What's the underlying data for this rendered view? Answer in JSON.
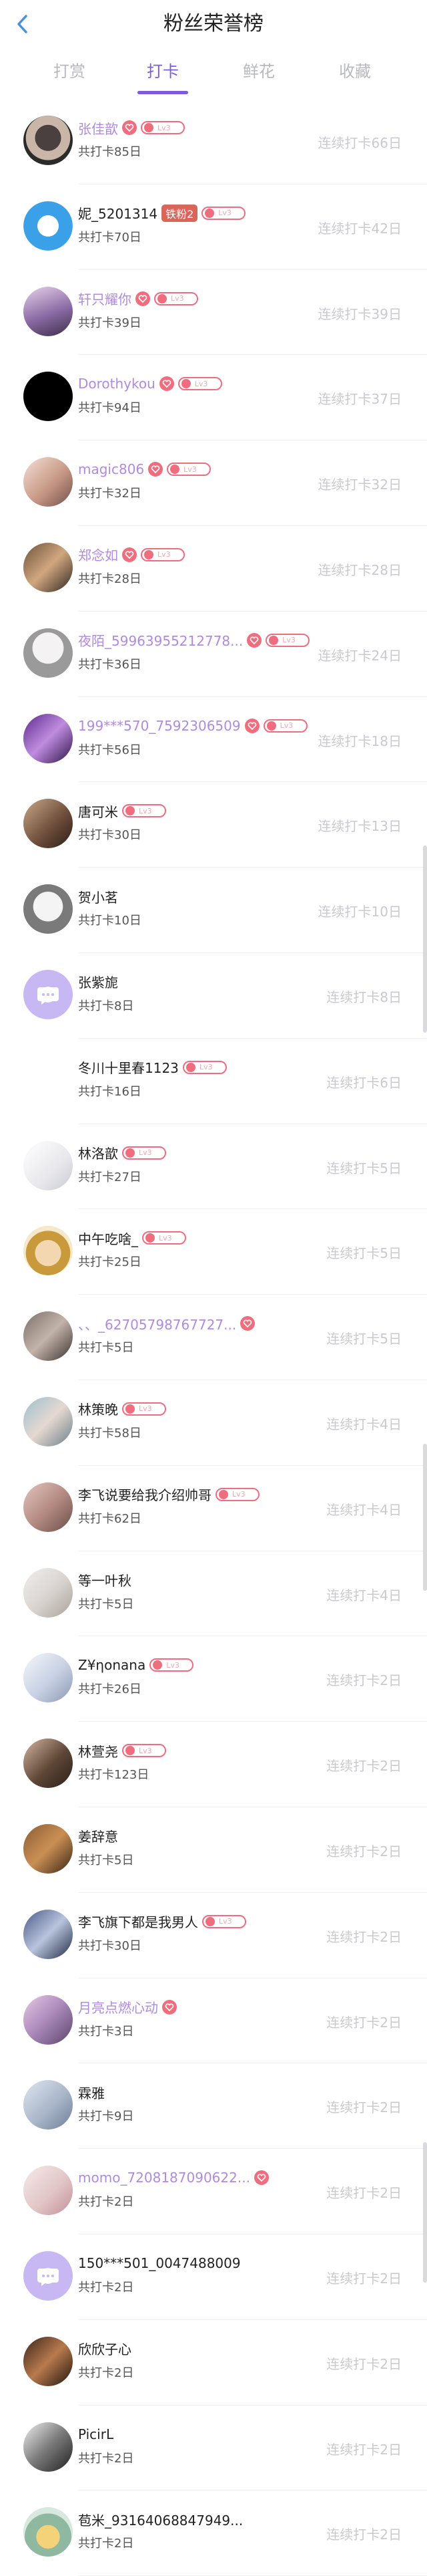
{
  "header": {
    "title": "粉丝荣誉榜"
  },
  "tabs": [
    {
      "label": "打赏"
    },
    {
      "label": "打卡"
    },
    {
      "label": "鲜花"
    },
    {
      "label": "收藏"
    }
  ],
  "badge_level_text": "Lv3",
  "colors": {
    "accent": "#7c5cd9",
    "badge": "#f06d7e",
    "vip_name": "#b08ae0",
    "muted": "#c9c9cf"
  },
  "rows": [
    {
      "name": "张佳歆",
      "sub": "共打卡85日",
      "streak": "连续打卡66日",
      "vip": true,
      "heart": true,
      "level": true
    },
    {
      "name": "妮_5201314",
      "sub": "共打卡70日",
      "streak": "连续打卡42日",
      "vip": false,
      "fans": "铁粉2",
      "level": true
    },
    {
      "name": "轩只耀你",
      "sub": "共打卡39日",
      "streak": "连续打卡39日",
      "vip": true,
      "heart": true,
      "level": true
    },
    {
      "name": "Dorothykou",
      "sub": "共打卡94日",
      "streak": "连续打卡37日",
      "vip": true,
      "heart": true,
      "level": true
    },
    {
      "name": "magic806",
      "sub": "共打卡32日",
      "streak": "连续打卡32日",
      "vip": true,
      "heart": true,
      "level": true
    },
    {
      "name": "郑念如",
      "sub": "共打卡28日",
      "streak": "连续打卡28日",
      "vip": true,
      "heart": true,
      "level": true
    },
    {
      "name": "夜陌_59963955212778...",
      "sub": "共打卡36日",
      "streak": "连续打卡24日",
      "vip": true,
      "heart": true,
      "level": true
    },
    {
      "name": "199***570_7592306509",
      "sub": "共打卡56日",
      "streak": "连续打卡18日",
      "vip": true,
      "heart": true,
      "level": true
    },
    {
      "name": "唐可米",
      "sub": "共打卡30日",
      "streak": "连续打卡13日",
      "vip": false,
      "level": true
    },
    {
      "name": "贺小茗",
      "sub": "共打卡10日",
      "streak": "连续打卡10日",
      "vip": false
    },
    {
      "name": "张紫旎",
      "sub": "共打卡8日",
      "streak": "连续打卡8日",
      "vip": false
    },
    {
      "name": "冬川十里春1123",
      "sub": "共打卡16日",
      "streak": "连续打卡6日",
      "vip": false,
      "level": true
    },
    {
      "name": "林洛歆",
      "sub": "共打卡27日",
      "streak": "连续打卡5日",
      "vip": false,
      "level": true
    },
    {
      "name": "中午吃啥_",
      "sub": "共打卡25日",
      "streak": "连续打卡5日",
      "vip": false,
      "level": true
    },
    {
      "name": "、、_62705798767727...",
      "sub": "共打卡5日",
      "streak": "连续打卡5日",
      "vip": true,
      "heart": true
    },
    {
      "name": "林策晚",
      "sub": "共打卡58日",
      "streak": "连续打卡4日",
      "vip": false,
      "level": true
    },
    {
      "name": "李飞说要给我介绍帅哥",
      "sub": "共打卡62日",
      "streak": "连续打卡4日",
      "vip": false,
      "level": true
    },
    {
      "name": "等一叶秋",
      "sub": "共打卡5日",
      "streak": "连续打卡4日",
      "vip": false
    },
    {
      "name": "Z¥ηonana",
      "sub": "共打卡26日",
      "streak": "连续打卡2日",
      "vip": false,
      "level": true
    },
    {
      "name": "林萱尧",
      "sub": "共打卡123日",
      "streak": "连续打卡2日",
      "vip": false,
      "level": true
    },
    {
      "name": "姜辞意",
      "sub": "共打卡5日",
      "streak": "连续打卡2日",
      "vip": false
    },
    {
      "name": "李飞旗下都是我男人",
      "sub": "共打卡30日",
      "streak": "连续打卡2日",
      "vip": false,
      "level": true
    },
    {
      "name": "月亮点燃心动",
      "sub": "共打卡3日",
      "streak": "连续打卡2日",
      "vip": true,
      "heart": true
    },
    {
      "name": "霖雅",
      "sub": "共打卡9日",
      "streak": "连续打卡2日",
      "vip": false
    },
    {
      "name": "momo_7208187090622...",
      "sub": "共打卡2日",
      "streak": "连续打卡2日",
      "vip": true,
      "heart": true
    },
    {
      "name": "150***501_0047488009",
      "sub": "共打卡2日",
      "streak": "连续打卡2日",
      "vip": false
    },
    {
      "name": "欣欣子心",
      "sub": "共打卡2日",
      "streak": "连续打卡2日",
      "vip": false
    },
    {
      "name": "PicirL",
      "sub": "共打卡2日",
      "streak": "连续打卡2日",
      "vip": false
    },
    {
      "name": "苞米_93164068847949...",
      "sub": "共打卡2日",
      "streak": "连续打卡2日",
      "vip": false
    }
  ]
}
